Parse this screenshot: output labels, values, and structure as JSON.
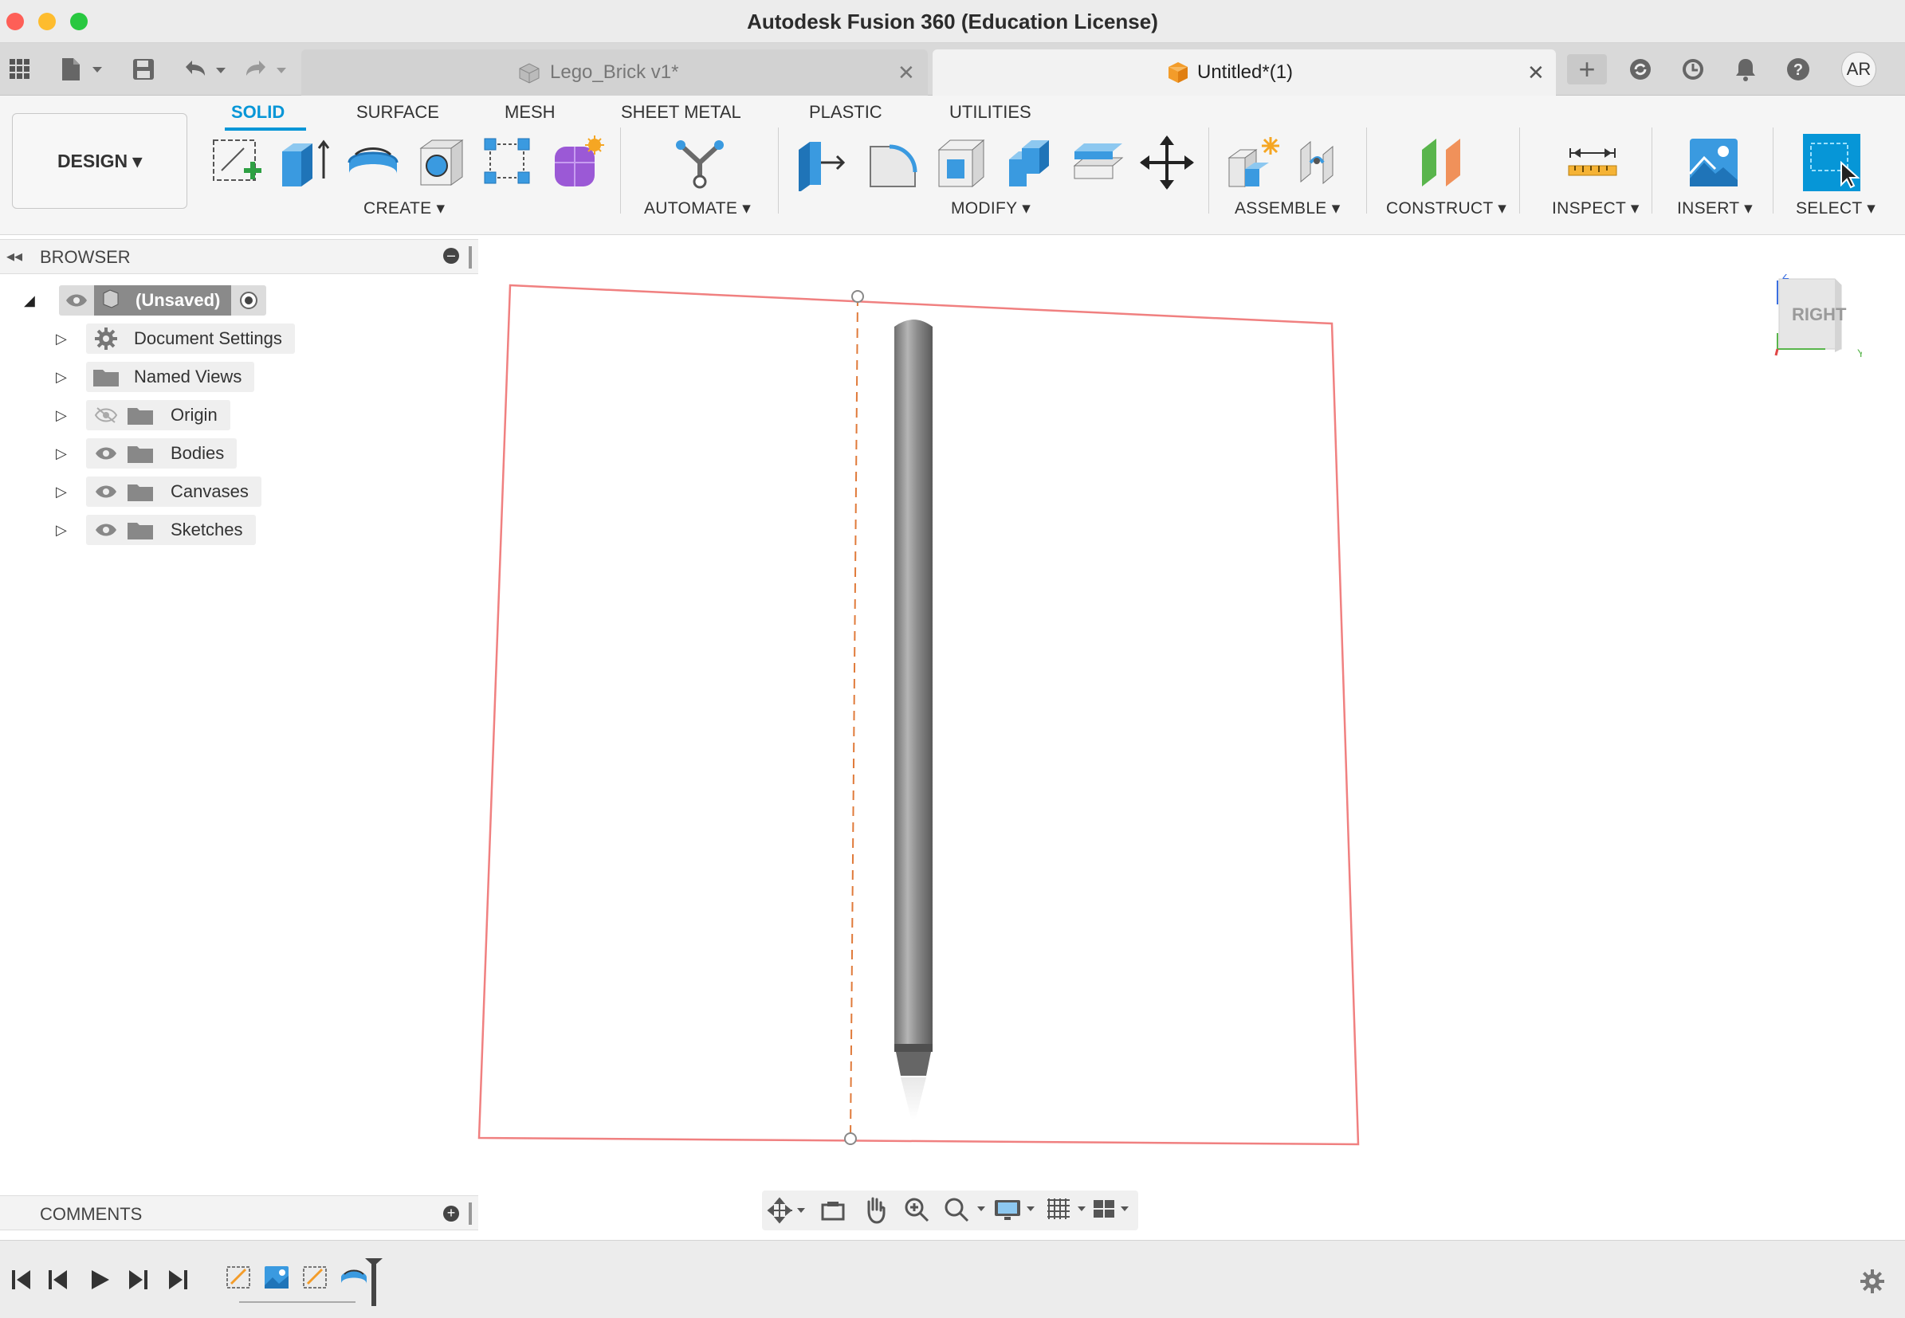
{
  "app": {
    "title": "Autodesk Fusion 360 (Education License)"
  },
  "tabs": [
    {
      "label": "Lego_Brick v1*",
      "active": false
    },
    {
      "label": "Untitled*(1)",
      "active": true
    }
  ],
  "user": {
    "initials": "AR"
  },
  "workspace": {
    "label": "DESIGN ▾"
  },
  "ribbon_tabs": [
    "SOLID",
    "SURFACE",
    "MESH",
    "SHEET METAL",
    "PLASTIC",
    "UTILITIES"
  ],
  "tool_groups": {
    "create": "CREATE ▾",
    "automate": "AUTOMATE ▾",
    "modify": "MODIFY ▾",
    "assemble": "ASSEMBLE ▾",
    "construct": "CONSTRUCT ▾",
    "inspect": "INSPECT ▾",
    "insert": "INSERT ▾",
    "select": "SELECT ▾"
  },
  "browser": {
    "title": "BROWSER",
    "root": "(Unsaved)",
    "items": [
      {
        "label": "Document Settings",
        "icon": "gear-icon"
      },
      {
        "label": "Named Views",
        "icon": "folder-icon"
      },
      {
        "label": "Origin",
        "icon": "folder-icon",
        "visibility": "hidden"
      },
      {
        "label": "Bodies",
        "icon": "folder-icon",
        "visibility": "visible"
      },
      {
        "label": "Canvases",
        "icon": "folder-icon",
        "visibility": "visible"
      },
      {
        "label": "Sketches",
        "icon": "folder-icon",
        "visibility": "visible"
      }
    ]
  },
  "viewcube": {
    "face": "RIGHT"
  },
  "comments": {
    "title": "COMMENTS"
  },
  "colors": {
    "accent": "#0696d7",
    "canvas_outline": "#f08080",
    "axis_dash": "#e07a3a"
  }
}
